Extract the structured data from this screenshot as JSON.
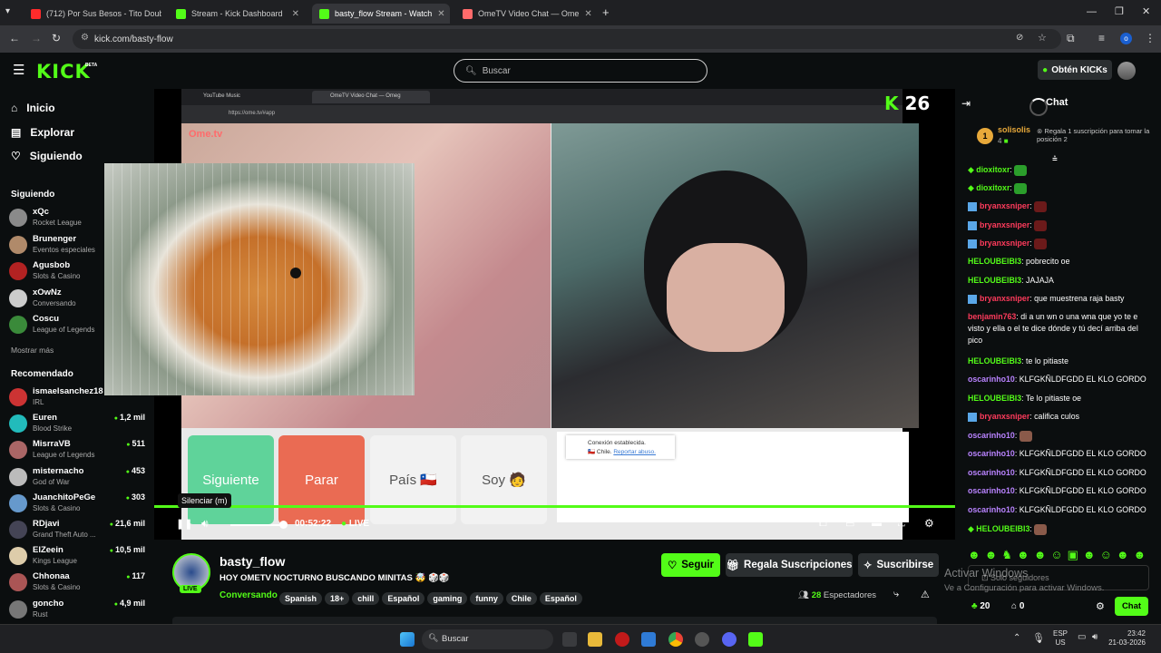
{
  "browser": {
    "tabs": [
      {
        "label": "(712) Por Sus Besos - Tito Doub",
        "color": "#ff2b2b"
      },
      {
        "label": "Stream - Kick Dashboard",
        "color": "#53fc18"
      },
      {
        "label": "basty_flow Stream - Watch",
        "color": "#53fc18",
        "active": true
      },
      {
        "label": "OmeTV Video Chat — Ome",
        "color": "#ff6b6b"
      }
    ],
    "url": "kick.com/basty-flow",
    "new_tab": "+"
  },
  "header": {
    "logo": "KICK",
    "beta": "BETA",
    "search_placeholder": "Buscar",
    "kicks_label": "Obtén KICKs"
  },
  "sidebar": {
    "nav": [
      "Inicio",
      "Explorar",
      "Siguiendo"
    ],
    "following_title": "Siguiendo",
    "following": [
      {
        "name": "xQc",
        "cat": "Rocket League",
        "color": "#8a8a8a"
      },
      {
        "name": "Brunenger",
        "cat": "Eventos especiales",
        "color": "#b08a6a"
      },
      {
        "name": "Agusbob",
        "cat": "Slots & Casino",
        "color": "#b22222"
      },
      {
        "name": "xOwNz",
        "cat": "Conversando",
        "color": "#ccc"
      },
      {
        "name": "Coscu",
        "cat": "League of Legends",
        "color": "#3a8a3a"
      }
    ],
    "show_more": "Mostrar más",
    "recommended_title": "Recomendado",
    "recommended": [
      {
        "name": "ismaelsanchez18",
        "cat": "IRL",
        "viewers": "",
        "color": "#c33"
      },
      {
        "name": "Euren",
        "cat": "Blood Strike",
        "viewers": "1,2 mil",
        "color": "#2bb"
      },
      {
        "name": "MisrraVB",
        "cat": "League of Legends",
        "viewers": "511",
        "color": "#a66"
      },
      {
        "name": "misternacho",
        "cat": "God of War",
        "viewers": "453",
        "color": "#bbb"
      },
      {
        "name": "JuanchitoPeGe",
        "cat": "Slots & Casino",
        "viewers": "303",
        "color": "#69c"
      },
      {
        "name": "RDjavi",
        "cat": "Grand Theft Auto ...",
        "viewers": "21,6 mil",
        "color": "#445"
      },
      {
        "name": "ElZeein",
        "cat": "Kings League",
        "viewers": "10,5 mil",
        "color": "#dca"
      },
      {
        "name": "Chhonaa",
        "cat": "Slots & Casino",
        "viewers": "117",
        "color": "#a55"
      },
      {
        "name": "goncho",
        "cat": "Rust",
        "viewers": "4,9 mil",
        "color": "#777"
      }
    ]
  },
  "video": {
    "inner_tabs": [
      "YouTube Music",
      "OmeTV Video Chat — Omeg"
    ],
    "inner_url": "https://ome.tv/#app",
    "ome_logo": "Ome.tv",
    "kick_rank": "26",
    "buttons": [
      {
        "label": "Siguiente",
        "color": "#5fd39a"
      },
      {
        "label": "Parar",
        "color": "#ea6b53"
      },
      {
        "label": "País 🇨🇱",
        "color": "#f2f2f2"
      },
      {
        "label": "Soy 🧑",
        "color": "#f2f2f2"
      }
    ],
    "connection": "Conexión establecida.",
    "country_line": "Chile.",
    "report": "Reportar abuso.",
    "tooltip": "Silenciar (m)",
    "time": "00:52:22",
    "live": "LIVE",
    "progress_fraction": 1.0
  },
  "stream": {
    "channel": "basty_flow",
    "title": "HOY OMETV NOCTURNO BUSCANDO MINITAS 🤯 🎲🎲",
    "category": "Conversando",
    "tags": [
      "Spanish",
      "18+",
      "chill",
      "Español",
      "gaming",
      "funny",
      "Chile",
      "Español"
    ],
    "live_badge": "LIVE",
    "follow": "Seguir",
    "gift": "Regala Suscripciones",
    "subscribe": "Suscribirse",
    "viewers": "28",
    "viewers_label": "Espectadores"
  },
  "chat": {
    "title": "Chat",
    "top_gifter": {
      "rank": "1",
      "name": "solisolis",
      "count": "4",
      "prompt": "Regala 1 suscripción para tomar la posición 2"
    },
    "messages": [
      {
        "user": "dioxitoxr",
        "text": "",
        "color": "#53fc18",
        "emote": "#2b9e2b",
        "badge": false
      },
      {
        "user": "dioxitoxr",
        "text": "",
        "color": "#53fc18",
        "emote": "#2b9e2b",
        "badge": false
      },
      {
        "user": "bryanxsniper",
        "text": "",
        "color": "#ff3b5c",
        "emote": "#6b1a1a",
        "badge": true
      },
      {
        "user": "bryanxsniper",
        "text": "",
        "color": "#ff3b5c",
        "emote": "#6b1a1a",
        "badge": true
      },
      {
        "user": "bryanxsniper",
        "text": "",
        "color": "#ff3b5c",
        "emote": "#6b1a1a",
        "badge": true
      },
      {
        "user": "HELOUBEIBI3",
        "text": "pobrecito oe",
        "color": "#53fc18",
        "badge": false
      },
      {
        "user": "HELOUBEIBI3",
        "text": "JAJAJA",
        "color": "#53fc18",
        "badge": false
      },
      {
        "user": "bryanxsniper",
        "text": "que muestrena raja basty",
        "color": "#ff3b5c",
        "badge": true
      },
      {
        "user": "benjamin763",
        "text": "di a un wn o una wna que yo te e visto y ella o el te dice dónde y tú decí arriba del pico",
        "color": "#ff3b5c",
        "badge": false
      },
      {
        "user": "HELOUBEIBI3",
        "text": "te lo pitiaste",
        "color": "#53fc18",
        "badge": false
      },
      {
        "user": "oscarinho10",
        "text": "KLFGKÑLDFGDD EL KLO GORDO",
        "color": "#b983ff",
        "badge": false
      },
      {
        "user": "HELOUBEIBI3",
        "text": "Te lo pitiaste oe",
        "color": "#53fc18",
        "badge": false
      },
      {
        "user": "bryanxsniper",
        "text": "califica culos",
        "color": "#ff3b5c",
        "badge": true
      },
      {
        "user": "oscarinho10",
        "text": "",
        "color": "#b983ff",
        "emote": "#8a5a4a",
        "badge": false
      },
      {
        "user": "oscarinho10",
        "text": "KLFGKÑLDFGDD EL KLO GORDO",
        "color": "#b983ff",
        "badge": false
      },
      {
        "user": "oscarinho10",
        "text": "KLFGKÑLDFGDD EL KLO GORDO",
        "color": "#b983ff",
        "badge": false
      },
      {
        "user": "oscarinho10",
        "text": "KLFGKÑLDFGDD EL KLO GORDO",
        "color": "#b983ff",
        "badge": false
      },
      {
        "user": "oscarinho10",
        "text": "KLFGKÑLDFGDD EL KLO GORDO",
        "color": "#b983ff",
        "badge": false
      },
      {
        "user": "HELOUBEIBI3",
        "text": "",
        "color": "#53fc18",
        "emote": "#8a5a4a",
        "badge": false
      }
    ],
    "input_placeholder": "Solo seguidores",
    "points": "20",
    "gifts": "0",
    "send": "Chat"
  },
  "watermark": {
    "line1": "Activar Windows",
    "line2": "Ve a Configuración para activar Windows."
  },
  "taskbar": {
    "search": "Buscar",
    "lang1": "ESP",
    "lang2": "US",
    "time": "23:42",
    "date": "21-03-2026"
  },
  "colors": {
    "accent": "#53fc18",
    "bg": "#0b0e0f"
  }
}
